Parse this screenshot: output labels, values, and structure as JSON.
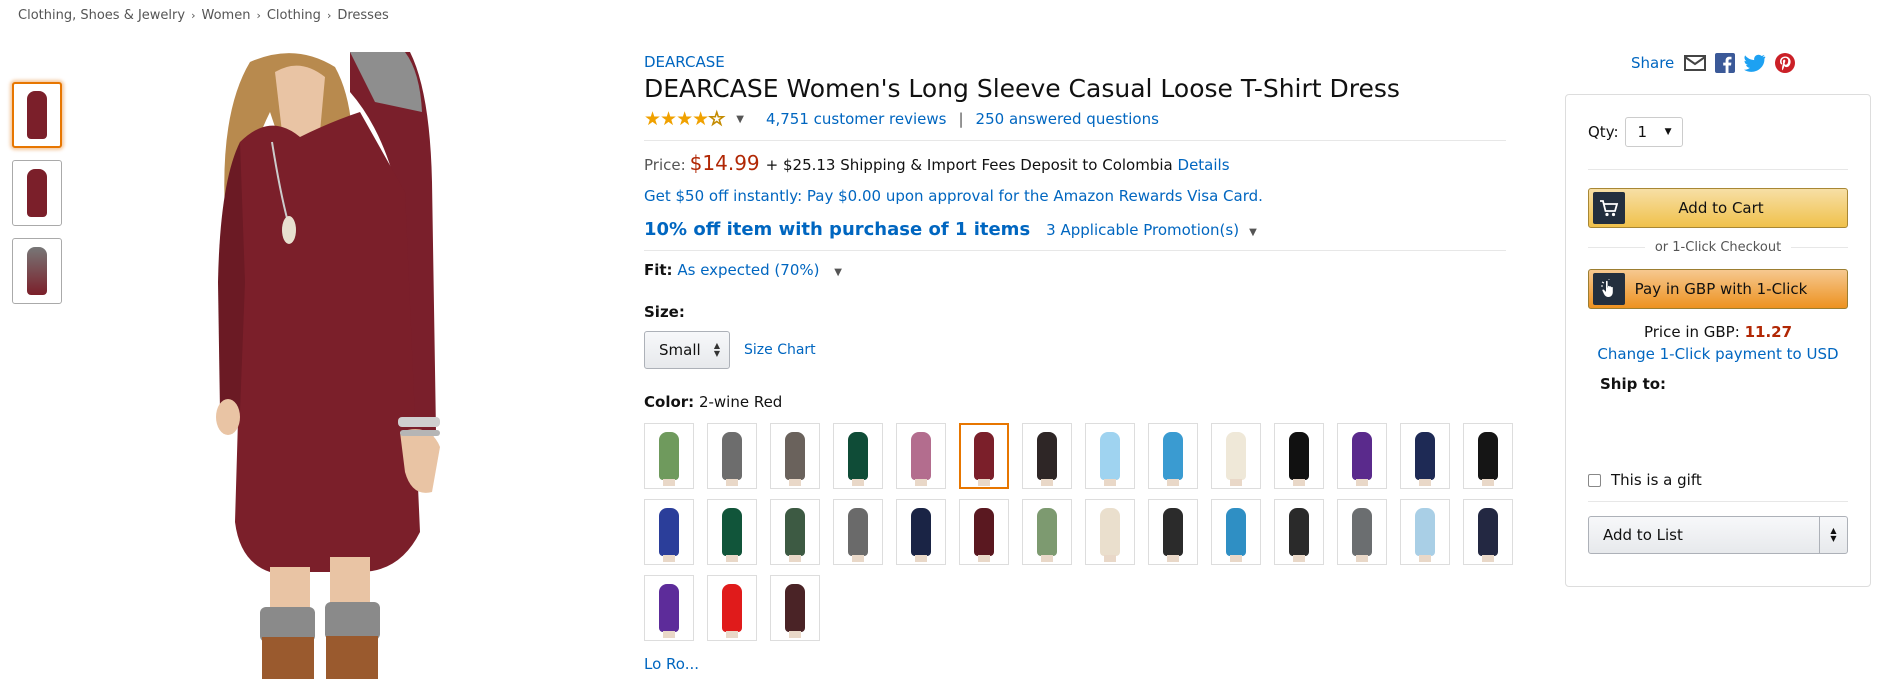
{
  "breadcrumb": [
    "Clothing, Shoes & Jewelry",
    "Women",
    "Clothing",
    "Dresses"
  ],
  "breadcrumb_separator": "›",
  "product": {
    "brand": "DEARCASE",
    "title": "DEARCASE Women's Long Sleeve Casual Loose T-Shirt Dress",
    "rating_stars": 4.0,
    "reviews": "4,751 customer reviews",
    "answered": "250 answered questions",
    "price_label": "Price:",
    "price": "$14.99",
    "shipping": "+ $25.13 Shipping & Import Fees Deposit to Colombia",
    "details_link": "Details",
    "rewards_offer": "Get $50 off instantly: Pay $0.00 upon approval for the Amazon Rewards Visa Card.",
    "promo_bold": "10% off item with purchase of 1 items",
    "promo_count": "3 Applicable Promotion(s)",
    "fit_label": "Fit:",
    "fit_value": "As expected (70%)",
    "size_label": "Size:",
    "size_value": "Small",
    "size_chart": "Size Chart",
    "color_label": "Color:",
    "color_value": "2-wine Red",
    "swatch_colors": [
      "#6f9a5d",
      "#6d6d6d",
      "#6a625c",
      "#0f4c37",
      "#b36d8e",
      "#7b1f2a",
      "#2e2626",
      "#9fd3f0",
      "#3a9bd1",
      "#efe8d8",
      "#111111",
      "#5a2a8c",
      "#1e2a55",
      "#151515",
      "#2b3e9a",
      "#11553a",
      "#3d5a43",
      "#6a6a6a",
      "#1a2445",
      "#5a1820",
      "#7d9a70",
      "#eadfcd",
      "#2b2b2b",
      "#2f8fc4",
      "#2a2a2a",
      "#6b6e70",
      "#a9cfe6",
      "#232842",
      "#5d2c9a",
      "#e01b1b",
      "#4a2326"
    ],
    "selected_swatch_index": 5,
    "cut_off_text": "Lo Ro..."
  },
  "share": {
    "label": "Share",
    "icons": [
      "email-icon",
      "facebook-icon",
      "twitter-icon",
      "pinterest-icon"
    ]
  },
  "buybox": {
    "qty_label": "Qty:",
    "qty_value": "1",
    "add_to_cart": "Add to Cart",
    "or_text": "or 1-Click Checkout",
    "one_click": "Pay in GBP with 1-Click",
    "price_gbp_label": "Price in GBP:",
    "price_gbp": "11.27",
    "change_link": "Change 1-Click payment to USD",
    "ship_to": "Ship to:",
    "gift": "This is a gift",
    "add_to_list": "Add to List"
  },
  "colors": {
    "link": "#0066c0",
    "price": "#b12704",
    "cart_button": "#f0c14b",
    "oneclick_button": "#ed9220",
    "dress": "#7b1f2a"
  }
}
